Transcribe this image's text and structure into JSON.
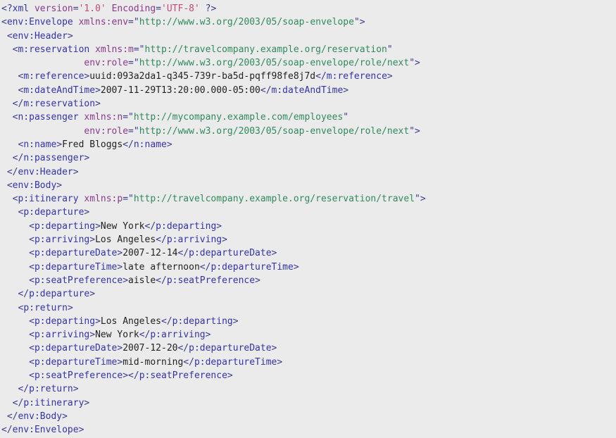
{
  "document": {
    "type": "xml",
    "title": "SOAP Envelope — travel reservation itinerary",
    "background_color": "#ebebeb",
    "colors": {
      "punctuation": "#3a3a8c",
      "tag_name": "#3333aa",
      "attribute_name": "#8b3a8b",
      "attribute_value": "#2f8b5c",
      "pi_attribute_value": "#c14b7a",
      "text_content": "#222222"
    },
    "prolog": {
      "open": "<?",
      "name": "xml",
      "attributes": [
        {
          "name": "version",
          "eq": "=",
          "value": "'1.0'"
        },
        {
          "name": "Encoding",
          "eq": "=",
          "value": "'UTF-8'"
        }
      ],
      "close": " ?>"
    },
    "lines": [
      {
        "indent": "",
        "segments": [
          {
            "t": "pi",
            "v": "<?"
          },
          {
            "t": "piname",
            "v": "xml"
          },
          {
            "t": "punct",
            "v": " "
          },
          {
            "t": "piattr",
            "v": "version"
          },
          {
            "t": "punct",
            "v": "="
          },
          {
            "t": "pival",
            "v": "'1.0'"
          },
          {
            "t": "punct",
            "v": " "
          },
          {
            "t": "piattr",
            "v": "Encoding"
          },
          {
            "t": "punct",
            "v": "="
          },
          {
            "t": "pival",
            "v": "'UTF-8'"
          },
          {
            "t": "pi",
            "v": " ?>"
          }
        ]
      },
      {
        "indent": "",
        "segments": [
          {
            "t": "punct",
            "v": "<"
          },
          {
            "t": "tag",
            "v": "env:Envelope"
          },
          {
            "t": "punct",
            "v": " "
          },
          {
            "t": "attr",
            "v": "xmlns:env"
          },
          {
            "t": "punct",
            "v": "=\""
          },
          {
            "t": "val",
            "v": "http://www.w3.org/2003/05/soap-envelope"
          },
          {
            "t": "punct",
            "v": "\">"
          }
        ]
      },
      {
        "indent": " ",
        "segments": [
          {
            "t": "punct",
            "v": "<"
          },
          {
            "t": "tag",
            "v": "env:Header"
          },
          {
            "t": "punct",
            "v": ">"
          }
        ]
      },
      {
        "indent": "  ",
        "segments": [
          {
            "t": "punct",
            "v": "<"
          },
          {
            "t": "tag",
            "v": "m:reservation"
          },
          {
            "t": "punct",
            "v": " "
          },
          {
            "t": "attr",
            "v": "xmlns:m"
          },
          {
            "t": "punct",
            "v": "=\""
          },
          {
            "t": "val",
            "v": "http://travelcompany.example.org/reservation"
          },
          {
            "t": "punct",
            "v": "\""
          }
        ]
      },
      {
        "indent": "               ",
        "segments": [
          {
            "t": "attr",
            "v": "env:role"
          },
          {
            "t": "punct",
            "v": "=\""
          },
          {
            "t": "val",
            "v": "http://www.w3.org/2003/05/soap-envelope/role/next"
          },
          {
            "t": "punct",
            "v": "\">"
          }
        ]
      },
      {
        "indent": "   ",
        "segments": [
          {
            "t": "punct",
            "v": "<"
          },
          {
            "t": "tag",
            "v": "m:reference"
          },
          {
            "t": "punct",
            "v": ">"
          },
          {
            "t": "txt",
            "v": "uuid:093a2da1-q345-739r-ba5d-pqff98fe8j7d"
          },
          {
            "t": "punct",
            "v": "</"
          },
          {
            "t": "tag",
            "v": "m:reference"
          },
          {
            "t": "punct",
            "v": ">"
          }
        ]
      },
      {
        "indent": "   ",
        "segments": [
          {
            "t": "punct",
            "v": "<"
          },
          {
            "t": "tag",
            "v": "m:dateAndTime"
          },
          {
            "t": "punct",
            "v": ">"
          },
          {
            "t": "txt",
            "v": "2007-11-29T13:20:00.000-05:00"
          },
          {
            "t": "punct",
            "v": "</"
          },
          {
            "t": "tag",
            "v": "m:dateAndTime"
          },
          {
            "t": "punct",
            "v": ">"
          }
        ]
      },
      {
        "indent": "  ",
        "segments": [
          {
            "t": "punct",
            "v": "</"
          },
          {
            "t": "tag",
            "v": "m:reservation"
          },
          {
            "t": "punct",
            "v": ">"
          }
        ]
      },
      {
        "indent": "  ",
        "segments": [
          {
            "t": "punct",
            "v": "<"
          },
          {
            "t": "tag",
            "v": "n:passenger"
          },
          {
            "t": "punct",
            "v": " "
          },
          {
            "t": "attr",
            "v": "xmlns:n"
          },
          {
            "t": "punct",
            "v": "=\""
          },
          {
            "t": "val",
            "v": "http://mycompany.example.com/employees"
          },
          {
            "t": "punct",
            "v": "\""
          }
        ]
      },
      {
        "indent": "               ",
        "segments": [
          {
            "t": "attr",
            "v": "env:role"
          },
          {
            "t": "punct",
            "v": "=\""
          },
          {
            "t": "val",
            "v": "http://www.w3.org/2003/05/soap-envelope/role/next"
          },
          {
            "t": "punct",
            "v": "\">"
          }
        ]
      },
      {
        "indent": "   ",
        "segments": [
          {
            "t": "punct",
            "v": "<"
          },
          {
            "t": "tag",
            "v": "n:name"
          },
          {
            "t": "punct",
            "v": ">"
          },
          {
            "t": "txt",
            "v": "Fred Bloggs"
          },
          {
            "t": "punct",
            "v": "</"
          },
          {
            "t": "tag",
            "v": "n:name"
          },
          {
            "t": "punct",
            "v": ">"
          }
        ]
      },
      {
        "indent": "  ",
        "segments": [
          {
            "t": "punct",
            "v": "</"
          },
          {
            "t": "tag",
            "v": "n:passenger"
          },
          {
            "t": "punct",
            "v": ">"
          }
        ]
      },
      {
        "indent": " ",
        "segments": [
          {
            "t": "punct",
            "v": "</"
          },
          {
            "t": "tag",
            "v": "env:Header"
          },
          {
            "t": "punct",
            "v": ">"
          }
        ]
      },
      {
        "indent": " ",
        "segments": [
          {
            "t": "punct",
            "v": "<"
          },
          {
            "t": "tag",
            "v": "env:Body"
          },
          {
            "t": "punct",
            "v": ">"
          }
        ]
      },
      {
        "indent": "  ",
        "segments": [
          {
            "t": "punct",
            "v": "<"
          },
          {
            "t": "tag",
            "v": "p:itinerary"
          },
          {
            "t": "punct",
            "v": " "
          },
          {
            "t": "attr",
            "v": "xmlns:p"
          },
          {
            "t": "punct",
            "v": "=\""
          },
          {
            "t": "val",
            "v": "http://travelcompany.example.org/reservation/travel"
          },
          {
            "t": "punct",
            "v": "\">"
          }
        ]
      },
      {
        "indent": "   ",
        "segments": [
          {
            "t": "punct",
            "v": "<"
          },
          {
            "t": "tag",
            "v": "p:departure"
          },
          {
            "t": "punct",
            "v": ">"
          }
        ]
      },
      {
        "indent": "     ",
        "segments": [
          {
            "t": "punct",
            "v": "<"
          },
          {
            "t": "tag",
            "v": "p:departing"
          },
          {
            "t": "punct",
            "v": ">"
          },
          {
            "t": "txt",
            "v": "New York"
          },
          {
            "t": "punct",
            "v": "</"
          },
          {
            "t": "tag",
            "v": "p:departing"
          },
          {
            "t": "punct",
            "v": ">"
          }
        ]
      },
      {
        "indent": "     ",
        "segments": [
          {
            "t": "punct",
            "v": "<"
          },
          {
            "t": "tag",
            "v": "p:arriving"
          },
          {
            "t": "punct",
            "v": ">"
          },
          {
            "t": "txt",
            "v": "Los Angeles"
          },
          {
            "t": "punct",
            "v": "</"
          },
          {
            "t": "tag",
            "v": "p:arriving"
          },
          {
            "t": "punct",
            "v": ">"
          }
        ]
      },
      {
        "indent": "     ",
        "segments": [
          {
            "t": "punct",
            "v": "<"
          },
          {
            "t": "tag",
            "v": "p:departureDate"
          },
          {
            "t": "punct",
            "v": ">"
          },
          {
            "t": "txt",
            "v": "2007-12-14"
          },
          {
            "t": "punct",
            "v": "</"
          },
          {
            "t": "tag",
            "v": "p:departureDate"
          },
          {
            "t": "punct",
            "v": ">"
          }
        ]
      },
      {
        "indent": "     ",
        "segments": [
          {
            "t": "punct",
            "v": "<"
          },
          {
            "t": "tag",
            "v": "p:departureTime"
          },
          {
            "t": "punct",
            "v": ">"
          },
          {
            "t": "txt",
            "v": "late afternoon"
          },
          {
            "t": "punct",
            "v": "</"
          },
          {
            "t": "tag",
            "v": "p:departureTime"
          },
          {
            "t": "punct",
            "v": ">"
          }
        ]
      },
      {
        "indent": "     ",
        "segments": [
          {
            "t": "punct",
            "v": "<"
          },
          {
            "t": "tag",
            "v": "p:seatPreference"
          },
          {
            "t": "punct",
            "v": ">"
          },
          {
            "t": "txt",
            "v": "aisle"
          },
          {
            "t": "punct",
            "v": "</"
          },
          {
            "t": "tag",
            "v": "p:seatPreference"
          },
          {
            "t": "punct",
            "v": ">"
          }
        ]
      },
      {
        "indent": "   ",
        "segments": [
          {
            "t": "punct",
            "v": "</"
          },
          {
            "t": "tag",
            "v": "p:departure"
          },
          {
            "t": "punct",
            "v": ">"
          }
        ]
      },
      {
        "indent": "   ",
        "segments": [
          {
            "t": "punct",
            "v": "<"
          },
          {
            "t": "tag",
            "v": "p:return"
          },
          {
            "t": "punct",
            "v": ">"
          }
        ]
      },
      {
        "indent": "     ",
        "segments": [
          {
            "t": "punct",
            "v": "<"
          },
          {
            "t": "tag",
            "v": "p:departing"
          },
          {
            "t": "punct",
            "v": ">"
          },
          {
            "t": "txt",
            "v": "Los Angeles"
          },
          {
            "t": "punct",
            "v": "</"
          },
          {
            "t": "tag",
            "v": "p:departing"
          },
          {
            "t": "punct",
            "v": ">"
          }
        ]
      },
      {
        "indent": "     ",
        "segments": [
          {
            "t": "punct",
            "v": "<"
          },
          {
            "t": "tag",
            "v": "p:arriving"
          },
          {
            "t": "punct",
            "v": ">"
          },
          {
            "t": "txt",
            "v": "New York"
          },
          {
            "t": "punct",
            "v": "</"
          },
          {
            "t": "tag",
            "v": "p:arriving"
          },
          {
            "t": "punct",
            "v": ">"
          }
        ]
      },
      {
        "indent": "     ",
        "segments": [
          {
            "t": "punct",
            "v": "<"
          },
          {
            "t": "tag",
            "v": "p:departureDate"
          },
          {
            "t": "punct",
            "v": ">"
          },
          {
            "t": "txt",
            "v": "2007-12-20"
          },
          {
            "t": "punct",
            "v": "</"
          },
          {
            "t": "tag",
            "v": "p:departureDate"
          },
          {
            "t": "punct",
            "v": ">"
          }
        ]
      },
      {
        "indent": "     ",
        "segments": [
          {
            "t": "punct",
            "v": "<"
          },
          {
            "t": "tag",
            "v": "p:departureTime"
          },
          {
            "t": "punct",
            "v": ">"
          },
          {
            "t": "txt",
            "v": "mid-morning"
          },
          {
            "t": "punct",
            "v": "</"
          },
          {
            "t": "tag",
            "v": "p:departureTime"
          },
          {
            "t": "punct",
            "v": ">"
          }
        ]
      },
      {
        "indent": "     ",
        "segments": [
          {
            "t": "punct",
            "v": "<"
          },
          {
            "t": "tag",
            "v": "p:seatPreference"
          },
          {
            "t": "punct",
            "v": ">"
          },
          {
            "t": "txt",
            "v": ""
          },
          {
            "t": "punct",
            "v": "</"
          },
          {
            "t": "tag",
            "v": "p:seatPreference"
          },
          {
            "t": "punct",
            "v": ">"
          }
        ]
      },
      {
        "indent": "   ",
        "segments": [
          {
            "t": "punct",
            "v": "</"
          },
          {
            "t": "tag",
            "v": "p:return"
          },
          {
            "t": "punct",
            "v": ">"
          }
        ]
      },
      {
        "indent": "  ",
        "segments": [
          {
            "t": "punct",
            "v": "</"
          },
          {
            "t": "tag",
            "v": "p:itinerary"
          },
          {
            "t": "punct",
            "v": ">"
          }
        ]
      },
      {
        "indent": " ",
        "segments": [
          {
            "t": "punct",
            "v": "</"
          },
          {
            "t": "tag",
            "v": "env:Body"
          },
          {
            "t": "punct",
            "v": ">"
          }
        ]
      },
      {
        "indent": "",
        "segments": [
          {
            "t": "punct",
            "v": "</"
          },
          {
            "t": "tag",
            "v": "env:Envelope"
          },
          {
            "t": "punct",
            "v": ">"
          }
        ]
      }
    ]
  }
}
